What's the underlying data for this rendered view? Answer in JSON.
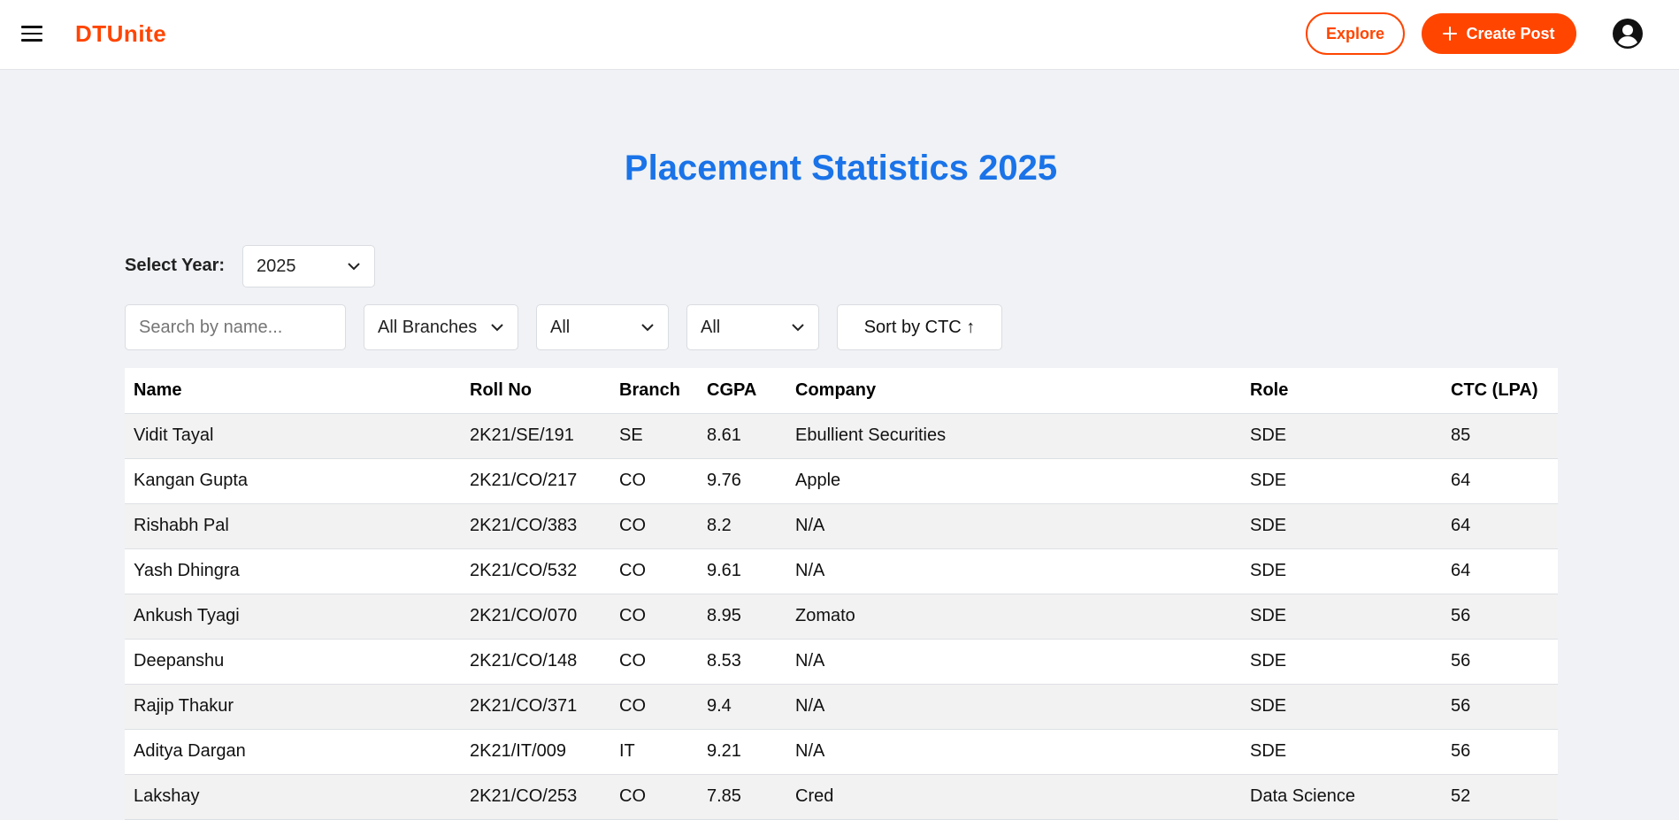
{
  "header": {
    "menu_icon": "hamburger-menu-icon",
    "logo": "DTUnite",
    "explore_label": "Explore",
    "create_post_label": "Create Post",
    "create_post_icon": "plus-icon",
    "account_icon": "user-account-icon",
    "brand_color": "#ff4500"
  },
  "main": {
    "title": "Placement Statistics 2025",
    "title_color": "#1a73e8",
    "year_select": {
      "label": "Select Year:",
      "value": "2025"
    },
    "filters": {
      "search_placeholder": "Search by name...",
      "branch_value": "All Branches",
      "filter2_value": "All",
      "filter3_value": "All",
      "sort_label": "Sort by CTC ↑"
    },
    "table": {
      "headers": [
        "Name",
        "Roll No",
        "Branch",
        "CGPA",
        "Company",
        "Role",
        "CTC (LPA)"
      ],
      "rows": [
        [
          "Vidit Tayal",
          "2K21/SE/191",
          "SE",
          "8.61",
          "Ebullient Securities",
          "SDE",
          "85"
        ],
        [
          "Kangan Gupta",
          "2K21/CO/217",
          "CO",
          "9.76",
          "Apple",
          "SDE",
          "64"
        ],
        [
          "Rishabh Pal",
          "2K21/CO/383",
          "CO",
          "8.2",
          "N/A",
          "SDE",
          "64"
        ],
        [
          "Yash Dhingra",
          "2K21/CO/532",
          "CO",
          "9.61",
          "N/A",
          "SDE",
          "64"
        ],
        [
          "Ankush Tyagi",
          "2K21/CO/070",
          "CO",
          "8.95",
          "Zomato",
          "SDE",
          "56"
        ],
        [
          "Deepanshu",
          "2K21/CO/148",
          "CO",
          "8.53",
          "N/A",
          "SDE",
          "56"
        ],
        [
          "Rajip Thakur",
          "2K21/CO/371",
          "CO",
          "9.4",
          "N/A",
          "SDE",
          "56"
        ],
        [
          "Aditya Dargan",
          "2K21/IT/009",
          "IT",
          "9.21",
          "N/A",
          "SDE",
          "56"
        ],
        [
          "Lakshay",
          "2K21/CO/253",
          "CO",
          "7.85",
          "Cred",
          "Data Science",
          "52"
        ]
      ]
    }
  }
}
